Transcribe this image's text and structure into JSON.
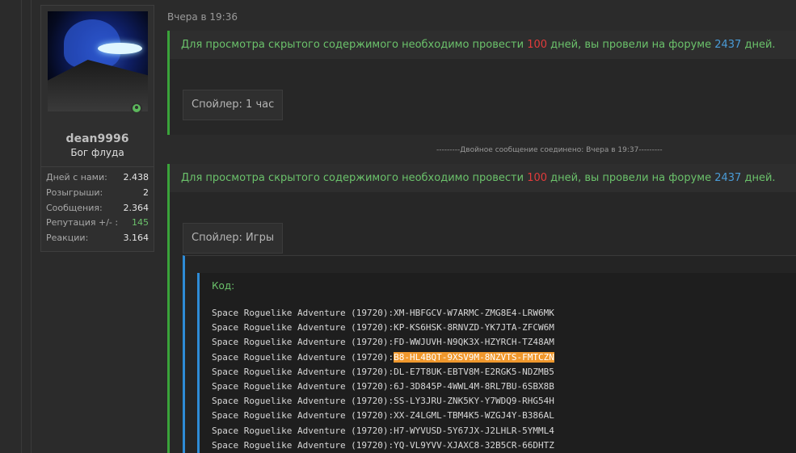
{
  "user": {
    "username": "dean9996",
    "title": "Бог флуда",
    "stats": [
      {
        "label": "Дней с нами:",
        "value": "2.438"
      },
      {
        "label": "Розыгрыши:",
        "value": "2"
      },
      {
        "label": "Сообщения:",
        "value": "2.364"
      },
      {
        "label": "Репутация +/- :",
        "value": "145"
      },
      {
        "label": "Реакции:",
        "value": "3.164"
      }
    ]
  },
  "post": {
    "timestamp": "Вчера в 19:36",
    "hidden_notice": {
      "prefix": "Для просмотра скрытого содержимого необходимо провести ",
      "required_days": "100",
      "middle": " дней, вы провели на форуме ",
      "user_days": "2437",
      "suffix": " дней."
    },
    "spoiler1_label": "Спойлер: 1 час",
    "merged_notice": "---------Двойное сообщение соединено: Вчера в 19:37---------",
    "spoiler2_label": "Спойлер: Игры",
    "code_label": "Код:",
    "code_lines": [
      {
        "game": "Space Roguelike Adventure (19720):",
        "key": "XM-HBFGCV-W7ARMC-ZMG8E4-LRW6MK"
      },
      {
        "game": "Space Roguelike Adventure (19720):",
        "key": "KP-KS6HSK-8RNVZD-YK7JTA-ZFCW6M"
      },
      {
        "game": "Space Roguelike Adventure (19720):",
        "key": "FD-WWJUVH-N9QK3X-HZYRCH-TZ48AM"
      },
      {
        "game": "Space Roguelike Adventure (19720):",
        "key": "B8-HL4BQT-9XSV9M-8NZVTS-FMTCZN"
      },
      {
        "game": "Space Roguelike Adventure (19720):",
        "key": "DL-E7T8UK-EBTV8M-E2RGK5-NDZMB5"
      },
      {
        "game": "Space Roguelike Adventure (19720):",
        "key": "6J-3D845P-4WWL4M-8RL7BU-6SBX8B"
      },
      {
        "game": "Space Roguelike Adventure (19720):",
        "key": "SS-LY3JRU-ZNK5KY-Y7WDQ9-RHG54H"
      },
      {
        "game": "Space Roguelike Adventure (19720):",
        "key": "XX-Z4LGML-TBM4K5-WZGJ4Y-B386AL"
      },
      {
        "game": "Space Roguelike Adventure (19720):",
        "key": "H7-WYVUSD-5Y67JX-J2LHLR-5YMML4"
      },
      {
        "game": "Space Roguelike Adventure (19720):",
        "key": "YQ-VL9YVV-XJAXC8-32B5CR-66DHTZ"
      }
    ],
    "highlighted_line_index": 3,
    "colors": {
      "accent_green": "#3aa33a",
      "accent_blue": "#2e8bd6",
      "highlight": "#f0982d",
      "red": "#e23b3b"
    }
  }
}
